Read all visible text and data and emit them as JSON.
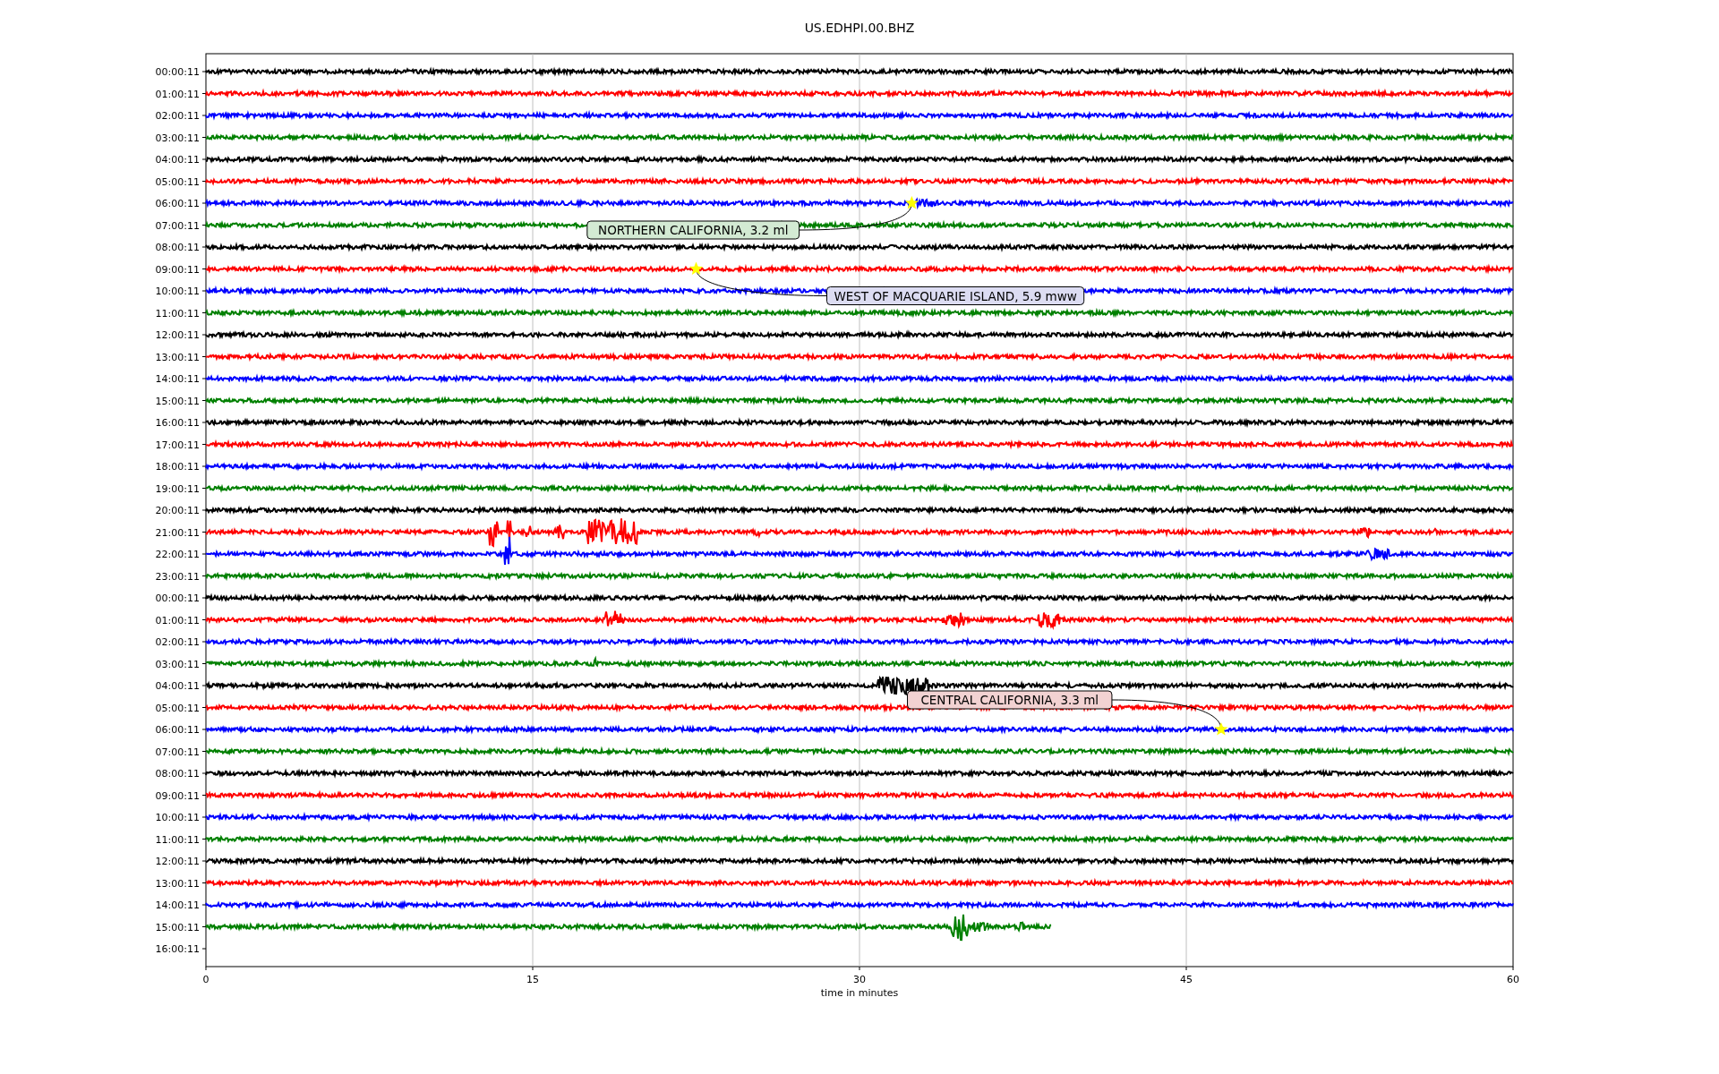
{
  "title": "US.EDHPI.00.BHZ",
  "xlabel": "time in minutes",
  "xticks": [
    "0",
    "15",
    "30",
    "45",
    "60"
  ],
  "rows": [
    {
      "label": "00:00:11",
      "color": "#000000",
      "kind": "full"
    },
    {
      "label": "01:00:11",
      "color": "#ff0000",
      "kind": "full"
    },
    {
      "label": "02:00:11",
      "color": "#0000ff",
      "kind": "full"
    },
    {
      "label": "03:00:11",
      "color": "#008000",
      "kind": "full"
    },
    {
      "label": "04:00:11",
      "color": "#000000",
      "kind": "full"
    },
    {
      "label": "05:00:11",
      "color": "#ff0000",
      "kind": "full"
    },
    {
      "label": "06:00:11",
      "color": "#0000ff",
      "kind": "full",
      "event": {
        "label": "NORTHERN CALIFORNIA, 3.2 ml",
        "color": "#d3ead3"
      }
    },
    {
      "label": "07:00:11",
      "color": "#008000",
      "kind": "full"
    },
    {
      "label": "08:00:11",
      "color": "#000000",
      "kind": "full"
    },
    {
      "label": "09:00:11",
      "color": "#ff0000",
      "kind": "full",
      "event": {
        "label": "WEST OF MACQUARIE ISLAND, 5.9 mww",
        "color": "#dcdcf2"
      }
    },
    {
      "label": "10:00:11",
      "color": "#0000ff",
      "kind": "full"
    },
    {
      "label": "11:00:11",
      "color": "#008000",
      "kind": "full"
    },
    {
      "label": "12:00:11",
      "color": "#000000",
      "kind": "full"
    },
    {
      "label": "13:00:11",
      "color": "#ff0000",
      "kind": "full"
    },
    {
      "label": "14:00:11",
      "color": "#0000ff",
      "kind": "full"
    },
    {
      "label": "15:00:11",
      "color": "#008000",
      "kind": "full"
    },
    {
      "label": "16:00:11",
      "color": "#000000",
      "kind": "full"
    },
    {
      "label": "17:00:11",
      "color": "#ff0000",
      "kind": "full"
    },
    {
      "label": "18:00:11",
      "color": "#0000ff",
      "kind": "full"
    },
    {
      "label": "19:00:11",
      "color": "#008000",
      "kind": "full"
    },
    {
      "label": "20:00:11",
      "color": "#000000",
      "kind": "full"
    },
    {
      "label": "21:00:11",
      "color": "#ff0000",
      "kind": "full"
    },
    {
      "label": "22:00:11",
      "color": "#0000ff",
      "kind": "full"
    },
    {
      "label": "23:00:11",
      "color": "#008000",
      "kind": "full"
    },
    {
      "label": "00:00:11",
      "color": "#000000",
      "kind": "full"
    },
    {
      "label": "01:00:11",
      "color": "#ff0000",
      "kind": "full"
    },
    {
      "label": "02:00:11",
      "color": "#0000ff",
      "kind": "full"
    },
    {
      "label": "03:00:11",
      "color": "#008000",
      "kind": "full"
    },
    {
      "label": "04:00:11",
      "color": "#000000",
      "kind": "full"
    },
    {
      "label": "05:00:11",
      "color": "#ff0000",
      "kind": "full"
    },
    {
      "label": "06:00:11",
      "color": "#0000ff",
      "kind": "full",
      "event": {
        "label": "CENTRAL CALIFORNIA, 3.3 ml",
        "color": "#f2d2d2"
      }
    },
    {
      "label": "07:00:11",
      "color": "#008000",
      "kind": "full"
    },
    {
      "label": "08:00:11",
      "color": "#000000",
      "kind": "full"
    },
    {
      "label": "09:00:11",
      "color": "#ff0000",
      "kind": "full"
    },
    {
      "label": "10:00:11",
      "color": "#0000ff",
      "kind": "full"
    },
    {
      "label": "11:00:11",
      "color": "#008000",
      "kind": "full"
    },
    {
      "label": "12:00:11",
      "color": "#000000",
      "kind": "full"
    },
    {
      "label": "13:00:11",
      "color": "#ff0000",
      "kind": "full"
    },
    {
      "label": "14:00:11",
      "color": "#0000ff",
      "kind": "full"
    },
    {
      "label": "15:00:11",
      "color": "#008000",
      "kind": "partial"
    },
    {
      "label": "16:00:11",
      "kind": "none"
    }
  ]
}
